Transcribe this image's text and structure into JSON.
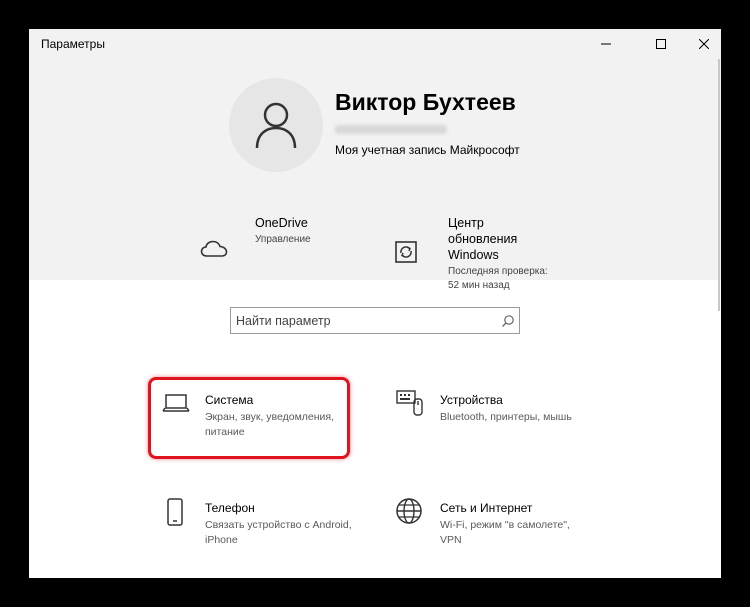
{
  "window": {
    "title": "Параметры"
  },
  "controls": {
    "minimize": "minimize",
    "maximize": "maximize",
    "close": "close"
  },
  "profile": {
    "name": "Виктор Бухтеев",
    "account_link": "Моя учетная запись Майкрософт"
  },
  "quick": [
    {
      "title": "OneDrive",
      "subtitle": "Управление",
      "icon": "cloud-icon"
    },
    {
      "title_lines": [
        "Центр",
        "обновления",
        "Windows"
      ],
      "subtitle_lines": [
        "Последняя проверка:",
        "52 мин назад"
      ],
      "icon": "update-icon"
    }
  ],
  "search": {
    "placeholder": "Найти параметр"
  },
  "tiles": [
    {
      "title": "Система",
      "sub_lines": [
        "Экран, звук, уведомления,",
        "питание"
      ],
      "icon": "laptop-icon"
    },
    {
      "title": "Устройства",
      "sub_lines": [
        "Bluetooth, принтеры, мышь"
      ],
      "icon": "keyboard-icon"
    },
    {
      "title": "Телефон",
      "sub_lines": [
        "Связать устройство с Android,",
        "iPhone"
      ],
      "icon": "phone-icon"
    },
    {
      "title": "Сеть и Интернет",
      "sub_lines": [
        "Wi-Fi, режим \"в самолете\",",
        "VPN"
      ],
      "icon": "globe-icon"
    }
  ],
  "colors": {
    "highlight": "#e0141e",
    "header_bg": "#f2f2f2"
  }
}
